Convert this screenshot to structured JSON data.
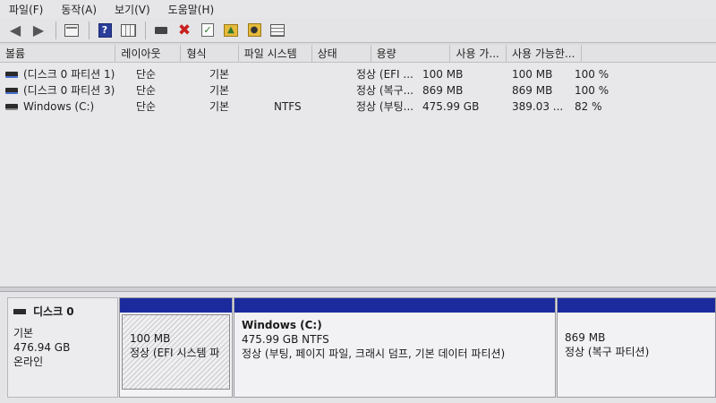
{
  "menu": [
    "파일(F)",
    "동작(A)",
    "보기(V)",
    "도움말(H)"
  ],
  "toolbar_icons": [
    "back-arrow-icon",
    "forward-arrow-icon",
    "console-tree-icon",
    "help-icon",
    "disk-list-icon",
    "connect-disk-icon",
    "delete-icon",
    "check-icon",
    "open-folder-icon",
    "explore-icon",
    "properties-list-icon"
  ],
  "columns": [
    "볼륨",
    "레이아웃",
    "형식",
    "파일 시스템",
    "상태",
    "용량",
    "사용 가...",
    "사용 가능한...",
    ""
  ],
  "volumes": [
    [
      "(디스크 0 파티션 1)",
      "단순",
      "기본",
      "",
      "정상 (EFI ...",
      "100 MB",
      "100 MB",
      "100 %"
    ],
    [
      "(디스크 0 파티션 3)",
      "단순",
      "기본",
      "",
      "정상 (복구...",
      "869 MB",
      "869 MB",
      "100 %"
    ],
    [
      "Windows (C:)",
      "단순",
      "기본",
      "NTFS",
      "정상 (부팅...",
      "475.99 GB",
      "389.03 ...",
      "82 %"
    ]
  ],
  "disk": {
    "title": "디스크 0",
    "type": "기본",
    "size": "476.94 GB",
    "status": "온라인"
  },
  "partitions": {
    "efi": {
      "size": "100 MB",
      "status": "정상 (EFI 시스템 파"
    },
    "windows": {
      "name": "Windows  (C:)",
      "size": "475.99 GB NTFS",
      "status": "정상 (부팅, 페이지 파일, 크래시 덤프, 기본 데이터 파티션)"
    },
    "recovery": {
      "size": "869 MB",
      "status": "정상 (복구 파티션)"
    }
  },
  "colors": {
    "partition_bar": "#1b2b9e",
    "background": "#dcdcde"
  }
}
